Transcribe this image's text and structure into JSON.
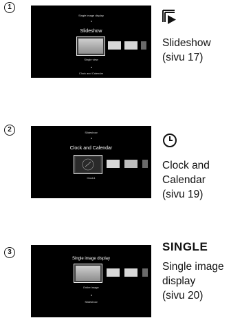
{
  "steps": [
    {
      "number": "1",
      "screen": {
        "top_text": "Single image display",
        "title": "Slideshow",
        "sub_text": "Single view",
        "bottom_text": "Clock and Calendar"
      },
      "icon": "slideshow-icon",
      "label_lines": [
        "Slideshow",
        "(sivu 17)"
      ]
    },
    {
      "number": "2",
      "screen": {
        "top_text": "Slideshow",
        "title": "Clock and Calendar",
        "sub_text": "Clock1"
      },
      "icon": "clock-icon",
      "label_lines": [
        "Clock and",
        "Calendar",
        "(sivu 19)"
      ]
    },
    {
      "number": "3",
      "screen": {
        "title": "Single image display",
        "sub_text": "Entire image",
        "bottom_text": "Slideshow"
      },
      "icon_text": "SINGLE",
      "label_lines": [
        "Single image",
        "display",
        "(sivu 20)"
      ]
    }
  ]
}
